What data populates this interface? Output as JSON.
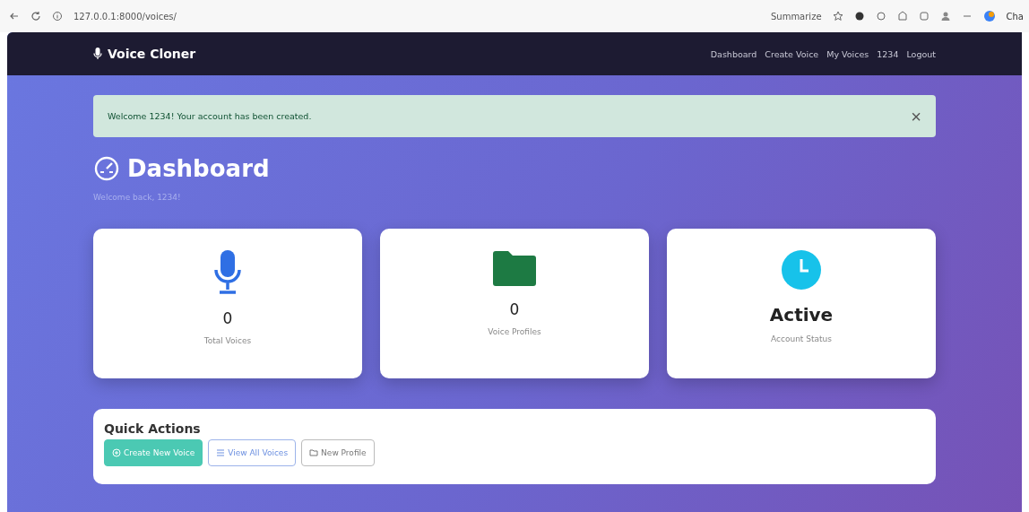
{
  "browser": {
    "url": "127.0.0.1:8000/voices/",
    "summarize": "Summarize",
    "chat": "Cha"
  },
  "navbar": {
    "brand": "Voice Cloner",
    "links": [
      "Dashboard",
      "Create Voice",
      "My Voices",
      "1234",
      "Logout"
    ]
  },
  "alert": {
    "message": "Welcome 1234! Your account has been created.",
    "close": "×"
  },
  "page": {
    "title": "Dashboard",
    "subtitle": "Welcome back, 1234!"
  },
  "stats": [
    {
      "kind": "mic",
      "value": "0",
      "label": "Total Voices"
    },
    {
      "kind": "folder",
      "value": "0",
      "label": "Voice Profiles"
    },
    {
      "kind": "clock",
      "value": "Active",
      "label": "Account Status"
    }
  ],
  "quick_actions": {
    "title": "Quick Actions",
    "buttons": [
      {
        "kind": "primary",
        "label": "Create New Voice"
      },
      {
        "kind": "outline-primary",
        "label": "View All Voices"
      },
      {
        "kind": "outline-secondary",
        "label": "New Profile"
      }
    ]
  }
}
